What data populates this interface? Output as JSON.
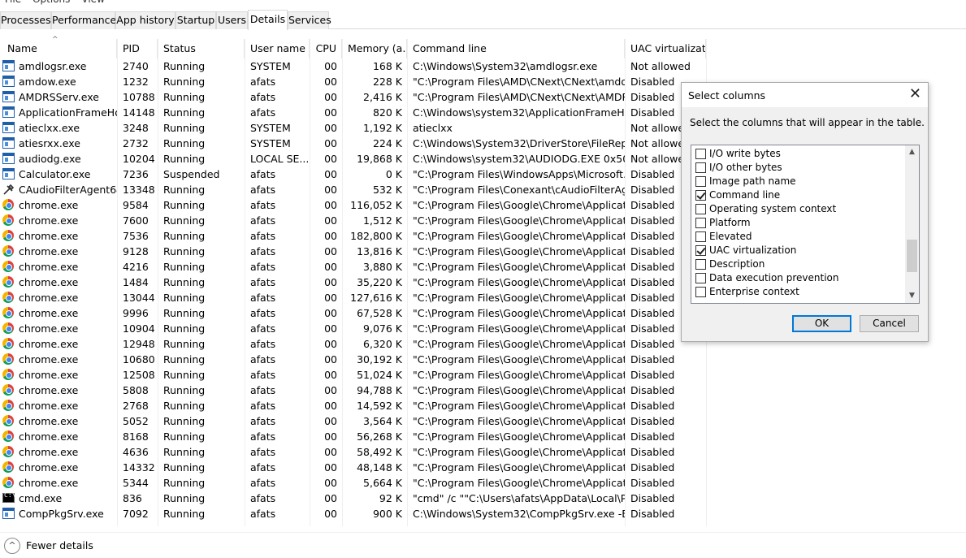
{
  "menu": [
    "File",
    "Options",
    "View"
  ],
  "tabs": [
    "Processes",
    "Performance",
    "App history",
    "Startup",
    "Users",
    "Details",
    "Services"
  ],
  "active_tab": "Details",
  "columns": [
    "Name",
    "PID",
    "Status",
    "User name",
    "CPU",
    "Memory (a...",
    "Command line",
    "UAC virtualizat..."
  ],
  "rows": [
    {
      "icon": "window-icon",
      "name": "amdlogsr.exe",
      "pid": "2740",
      "status": "Running",
      "user": "SYSTEM",
      "cpu": "00",
      "mem": "168 K",
      "cmd": "C:\\Windows\\System32\\amdlogsr.exe",
      "uac": "Not allowed"
    },
    {
      "icon": "window-icon",
      "name": "amdow.exe",
      "pid": "1232",
      "status": "Running",
      "user": "afats",
      "cpu": "00",
      "mem": "228 K",
      "cmd": "\"C:\\Program Files\\AMD\\CNext\\CNext\\amdow...",
      "uac": "Disabled"
    },
    {
      "icon": "window-icon",
      "name": "AMDRSServ.exe",
      "pid": "10788",
      "status": "Running",
      "user": "afats",
      "cpu": "00",
      "mem": "2,416 K",
      "cmd": "\"C:\\Program Files\\AMD\\CNext\\CNext\\AMDRS...",
      "uac": "Disabled"
    },
    {
      "icon": "window-icon",
      "name": "ApplicationFrameHo...",
      "pid": "14148",
      "status": "Running",
      "user": "afats",
      "cpu": "00",
      "mem": "820 K",
      "cmd": "C:\\Windows\\system32\\ApplicationFrameHost....",
      "uac": "Disabled"
    },
    {
      "icon": "window-icon",
      "name": "atieclxx.exe",
      "pid": "3248",
      "status": "Running",
      "user": "SYSTEM",
      "cpu": "00",
      "mem": "1,192 K",
      "cmd": "atieclxx",
      "uac": "Not allowed"
    },
    {
      "icon": "window-icon",
      "name": "atiesrxx.exe",
      "pid": "2732",
      "status": "Running",
      "user": "SYSTEM",
      "cpu": "00",
      "mem": "224 K",
      "cmd": "C:\\Windows\\System32\\DriverStore\\FileReposit...",
      "uac": "Not allowed"
    },
    {
      "icon": "window-icon",
      "name": "audiodg.exe",
      "pid": "10204",
      "status": "Running",
      "user": "LOCAL SE...",
      "cpu": "00",
      "mem": "19,868 K",
      "cmd": "C:\\Windows\\system32\\AUDIODG.EXE 0x50c",
      "uac": "Not allowed"
    },
    {
      "icon": "window-icon",
      "name": "Calculator.exe",
      "pid": "7236",
      "status": "Suspended",
      "user": "afats",
      "cpu": "00",
      "mem": "0 K",
      "cmd": "\"C:\\Program Files\\WindowsApps\\Microsoft.W...",
      "uac": "Disabled"
    },
    {
      "icon": "tool-icon",
      "name": "CAudioFilterAgent64....",
      "pid": "13348",
      "status": "Running",
      "user": "afats",
      "cpu": "00",
      "mem": "532 K",
      "cmd": "\"C:\\Program Files\\Conexant\\cAudioFilterAgen...",
      "uac": "Disabled"
    },
    {
      "icon": "chrome-icon",
      "name": "chrome.exe",
      "pid": "9584",
      "status": "Running",
      "user": "afats",
      "cpu": "00",
      "mem": "116,052 K",
      "cmd": "\"C:\\Program Files\\Google\\Chrome\\Applicatio...",
      "uac": "Disabled"
    },
    {
      "icon": "chrome-icon",
      "name": "chrome.exe",
      "pid": "7600",
      "status": "Running",
      "user": "afats",
      "cpu": "00",
      "mem": "1,512 K",
      "cmd": "\"C:\\Program Files\\Google\\Chrome\\Applicatio...",
      "uac": "Disabled"
    },
    {
      "icon": "chrome-icon",
      "name": "chrome.exe",
      "pid": "7536",
      "status": "Running",
      "user": "afats",
      "cpu": "00",
      "mem": "182,800 K",
      "cmd": "\"C:\\Program Files\\Google\\Chrome\\Applicatio...",
      "uac": "Disabled"
    },
    {
      "icon": "chrome-icon",
      "name": "chrome.exe",
      "pid": "9128",
      "status": "Running",
      "user": "afats",
      "cpu": "00",
      "mem": "13,816 K",
      "cmd": "\"C:\\Program Files\\Google\\Chrome\\Applicatio...",
      "uac": "Disabled"
    },
    {
      "icon": "chrome-icon",
      "name": "chrome.exe",
      "pid": "4216",
      "status": "Running",
      "user": "afats",
      "cpu": "00",
      "mem": "3,880 K",
      "cmd": "\"C:\\Program Files\\Google\\Chrome\\Applicatio...",
      "uac": "Disabled"
    },
    {
      "icon": "chrome-icon",
      "name": "chrome.exe",
      "pid": "1484",
      "status": "Running",
      "user": "afats",
      "cpu": "00",
      "mem": "35,220 K",
      "cmd": "\"C:\\Program Files\\Google\\Chrome\\Applicatio...",
      "uac": "Disabled"
    },
    {
      "icon": "chrome-icon",
      "name": "chrome.exe",
      "pid": "13044",
      "status": "Running",
      "user": "afats",
      "cpu": "00",
      "mem": "127,616 K",
      "cmd": "\"C:\\Program Files\\Google\\Chrome\\Applicatio...",
      "uac": "Disabled"
    },
    {
      "icon": "chrome-icon",
      "name": "chrome.exe",
      "pid": "9996",
      "status": "Running",
      "user": "afats",
      "cpu": "00",
      "mem": "67,528 K",
      "cmd": "\"C:\\Program Files\\Google\\Chrome\\Applicatio...",
      "uac": "Disabled"
    },
    {
      "icon": "chrome-icon",
      "name": "chrome.exe",
      "pid": "10904",
      "status": "Running",
      "user": "afats",
      "cpu": "00",
      "mem": "9,076 K",
      "cmd": "\"C:\\Program Files\\Google\\Chrome\\Applicatio...",
      "uac": "Disabled"
    },
    {
      "icon": "chrome-icon",
      "name": "chrome.exe",
      "pid": "12948",
      "status": "Running",
      "user": "afats",
      "cpu": "00",
      "mem": "6,320 K",
      "cmd": "\"C:\\Program Files\\Google\\Chrome\\Applicatio...",
      "uac": "Disabled"
    },
    {
      "icon": "chrome-icon",
      "name": "chrome.exe",
      "pid": "10680",
      "status": "Running",
      "user": "afats",
      "cpu": "00",
      "mem": "30,192 K",
      "cmd": "\"C:\\Program Files\\Google\\Chrome\\Applicatio...",
      "uac": "Disabled"
    },
    {
      "icon": "chrome-icon",
      "name": "chrome.exe",
      "pid": "12508",
      "status": "Running",
      "user": "afats",
      "cpu": "00",
      "mem": "51,024 K",
      "cmd": "\"C:\\Program Files\\Google\\Chrome\\Applicatio...",
      "uac": "Disabled"
    },
    {
      "icon": "chrome-icon",
      "name": "chrome.exe",
      "pid": "5808",
      "status": "Running",
      "user": "afats",
      "cpu": "00",
      "mem": "94,788 K",
      "cmd": "\"C:\\Program Files\\Google\\Chrome\\Applicatio...",
      "uac": "Disabled"
    },
    {
      "icon": "chrome-icon",
      "name": "chrome.exe",
      "pid": "2768",
      "status": "Running",
      "user": "afats",
      "cpu": "00",
      "mem": "14,592 K",
      "cmd": "\"C:\\Program Files\\Google\\Chrome\\Applicatio...",
      "uac": "Disabled"
    },
    {
      "icon": "chrome-icon",
      "name": "chrome.exe",
      "pid": "5052",
      "status": "Running",
      "user": "afats",
      "cpu": "00",
      "mem": "3,564 K",
      "cmd": "\"C:\\Program Files\\Google\\Chrome\\Applicatio...",
      "uac": "Disabled"
    },
    {
      "icon": "chrome-icon",
      "name": "chrome.exe",
      "pid": "8168",
      "status": "Running",
      "user": "afats",
      "cpu": "00",
      "mem": "56,268 K",
      "cmd": "\"C:\\Program Files\\Google\\Chrome\\Applicatio...",
      "uac": "Disabled"
    },
    {
      "icon": "chrome-icon",
      "name": "chrome.exe",
      "pid": "4636",
      "status": "Running",
      "user": "afats",
      "cpu": "00",
      "mem": "58,492 K",
      "cmd": "\"C:\\Program Files\\Google\\Chrome\\Applicatio...",
      "uac": "Disabled"
    },
    {
      "icon": "chrome-icon",
      "name": "chrome.exe",
      "pid": "14332",
      "status": "Running",
      "user": "afats",
      "cpu": "00",
      "mem": "48,148 K",
      "cmd": "\"C:\\Program Files\\Google\\Chrome\\Applicatio...",
      "uac": "Disabled"
    },
    {
      "icon": "chrome-icon",
      "name": "chrome.exe",
      "pid": "5344",
      "status": "Running",
      "user": "afats",
      "cpu": "00",
      "mem": "5,664 K",
      "cmd": "\"C:\\Program Files\\Google\\Chrome\\Applicatio...",
      "uac": "Disabled"
    },
    {
      "icon": "cmd-icon",
      "name": "cmd.exe",
      "pid": "836",
      "status": "Running",
      "user": "afats",
      "cpu": "00",
      "mem": "92 K",
      "cmd": "\"cmd\" /c \"\"C:\\Users\\afats\\AppData\\Local\\Pro...",
      "uac": "Disabled"
    },
    {
      "icon": "window-icon",
      "name": "CompPkgSrv.exe",
      "pid": "7092",
      "status": "Running",
      "user": "afats",
      "cpu": "00",
      "mem": "900 K",
      "cmd": "C:\\Windows\\System32\\CompPkgSrv.exe -Em...",
      "uac": "Disabled"
    }
  ],
  "footer": {
    "fewer_details": "Fewer details"
  },
  "dialog": {
    "title": "Select columns",
    "description": "Select the columns that will appear in the table.",
    "options": [
      {
        "label": "I/O write bytes",
        "checked": false
      },
      {
        "label": "I/O other bytes",
        "checked": false
      },
      {
        "label": "Image path name",
        "checked": false
      },
      {
        "label": "Command line",
        "checked": true
      },
      {
        "label": "Operating system context",
        "checked": false
      },
      {
        "label": "Platform",
        "checked": false
      },
      {
        "label": "Elevated",
        "checked": false
      },
      {
        "label": "UAC virtualization",
        "checked": true
      },
      {
        "label": "Description",
        "checked": false
      },
      {
        "label": "Data execution prevention",
        "checked": false
      },
      {
        "label": "Enterprise context",
        "checked": false
      }
    ],
    "ok_label": "OK",
    "cancel_label": "Cancel"
  },
  "colors": {
    "accent": "#0078d7",
    "icon_blue": "#1f5ea8"
  }
}
